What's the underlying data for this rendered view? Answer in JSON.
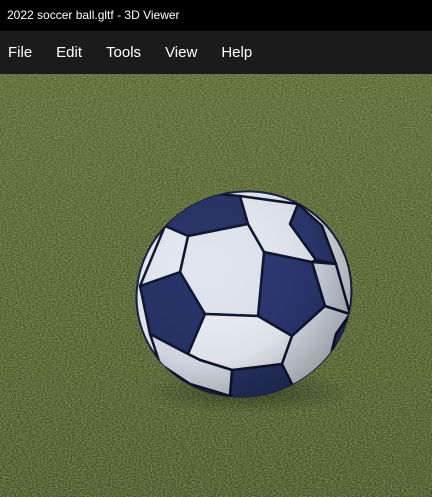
{
  "window": {
    "title": "2022 soccer ball.gltf - 3D Viewer"
  },
  "menu": {
    "items": [
      {
        "label": "File"
      },
      {
        "label": "Edit"
      },
      {
        "label": "Tools"
      },
      {
        "label": "View"
      },
      {
        "label": "Help"
      }
    ]
  },
  "viewport": {
    "scene": "soccer-ball-on-grass",
    "colors": {
      "grass": "#4d5a2a",
      "ball_white": "#e6ebf3",
      "ball_navy": "#273366",
      "seam": "#0f1530"
    }
  }
}
